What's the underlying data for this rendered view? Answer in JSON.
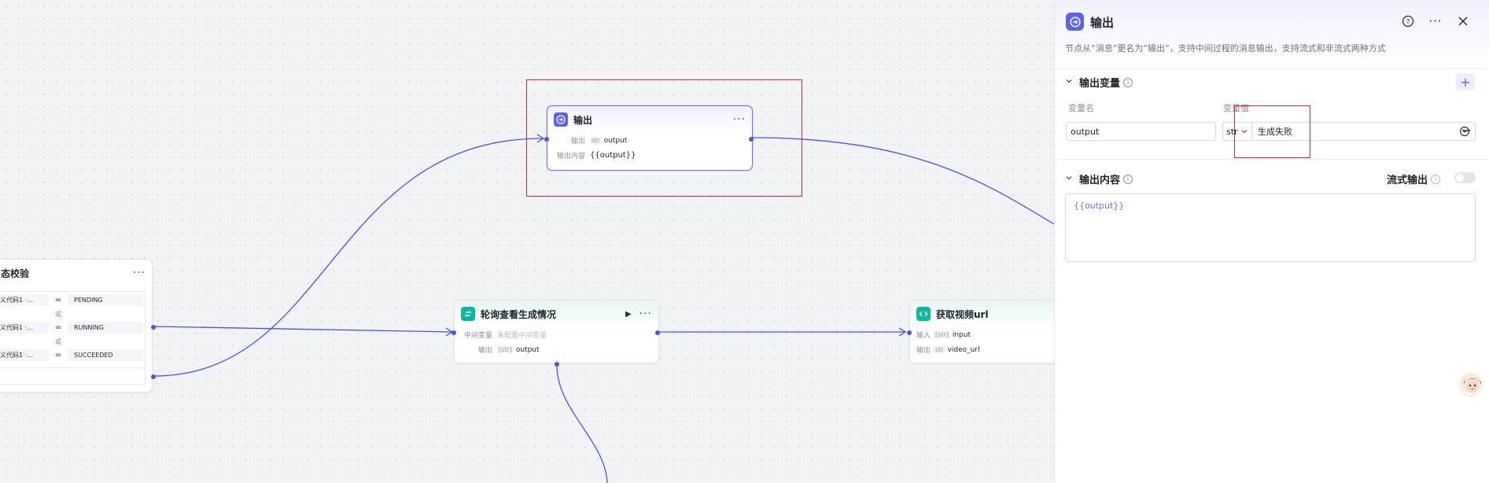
{
  "canvas": {
    "condition_node": {
      "title": "态校验",
      "rows": [
        {
          "var": "义代码1 ·…",
          "op": "=",
          "value": "PENDING"
        },
        {
          "var": "义代码1 ·…",
          "op": "=",
          "value": "RUNNING"
        },
        {
          "var": "义代码1 ·…",
          "op": "=",
          "value": "SUCCEEDED"
        }
      ],
      "or_label": "或"
    },
    "output_node": {
      "title": "输出",
      "row1_label": "输出",
      "row1_tag": "str",
      "row1_value": "output",
      "row2_label": "输出内容",
      "row2_value": "{{output}}"
    },
    "loop_node": {
      "title": "轮询查看生成情况",
      "row1_label": "中间变量",
      "row1_value": "未配置中间变量",
      "row2_label": "输出",
      "row2_tag": "[str]",
      "row2_value": "output"
    },
    "code_node": {
      "title": "获取视频url",
      "row1_label": "输入",
      "row1_tag": "[str]",
      "row1_value": "input",
      "row2_label": "输出",
      "row2_tag": "str",
      "row2_value": "video_url"
    }
  },
  "panel": {
    "title": "输出",
    "description": "节点从“消息”更名为“输出”，支持中间过程的消息输出，支持流式和非流式两种方式",
    "output_vars": {
      "section_title": "输出变量",
      "name_header": "变量名",
      "value_header": "变量值",
      "name_value": "output",
      "type_value": "str",
      "value_value": "生成失败"
    },
    "output_content": {
      "section_title": "输出内容",
      "stream_label": "流式输出",
      "stream_enabled": false,
      "content": "{{output}}"
    }
  },
  "colors": {
    "accent": "#5b61f0",
    "edge": "#4b52e8",
    "teal": "#12b5a3",
    "highlight": "#e02424"
  }
}
